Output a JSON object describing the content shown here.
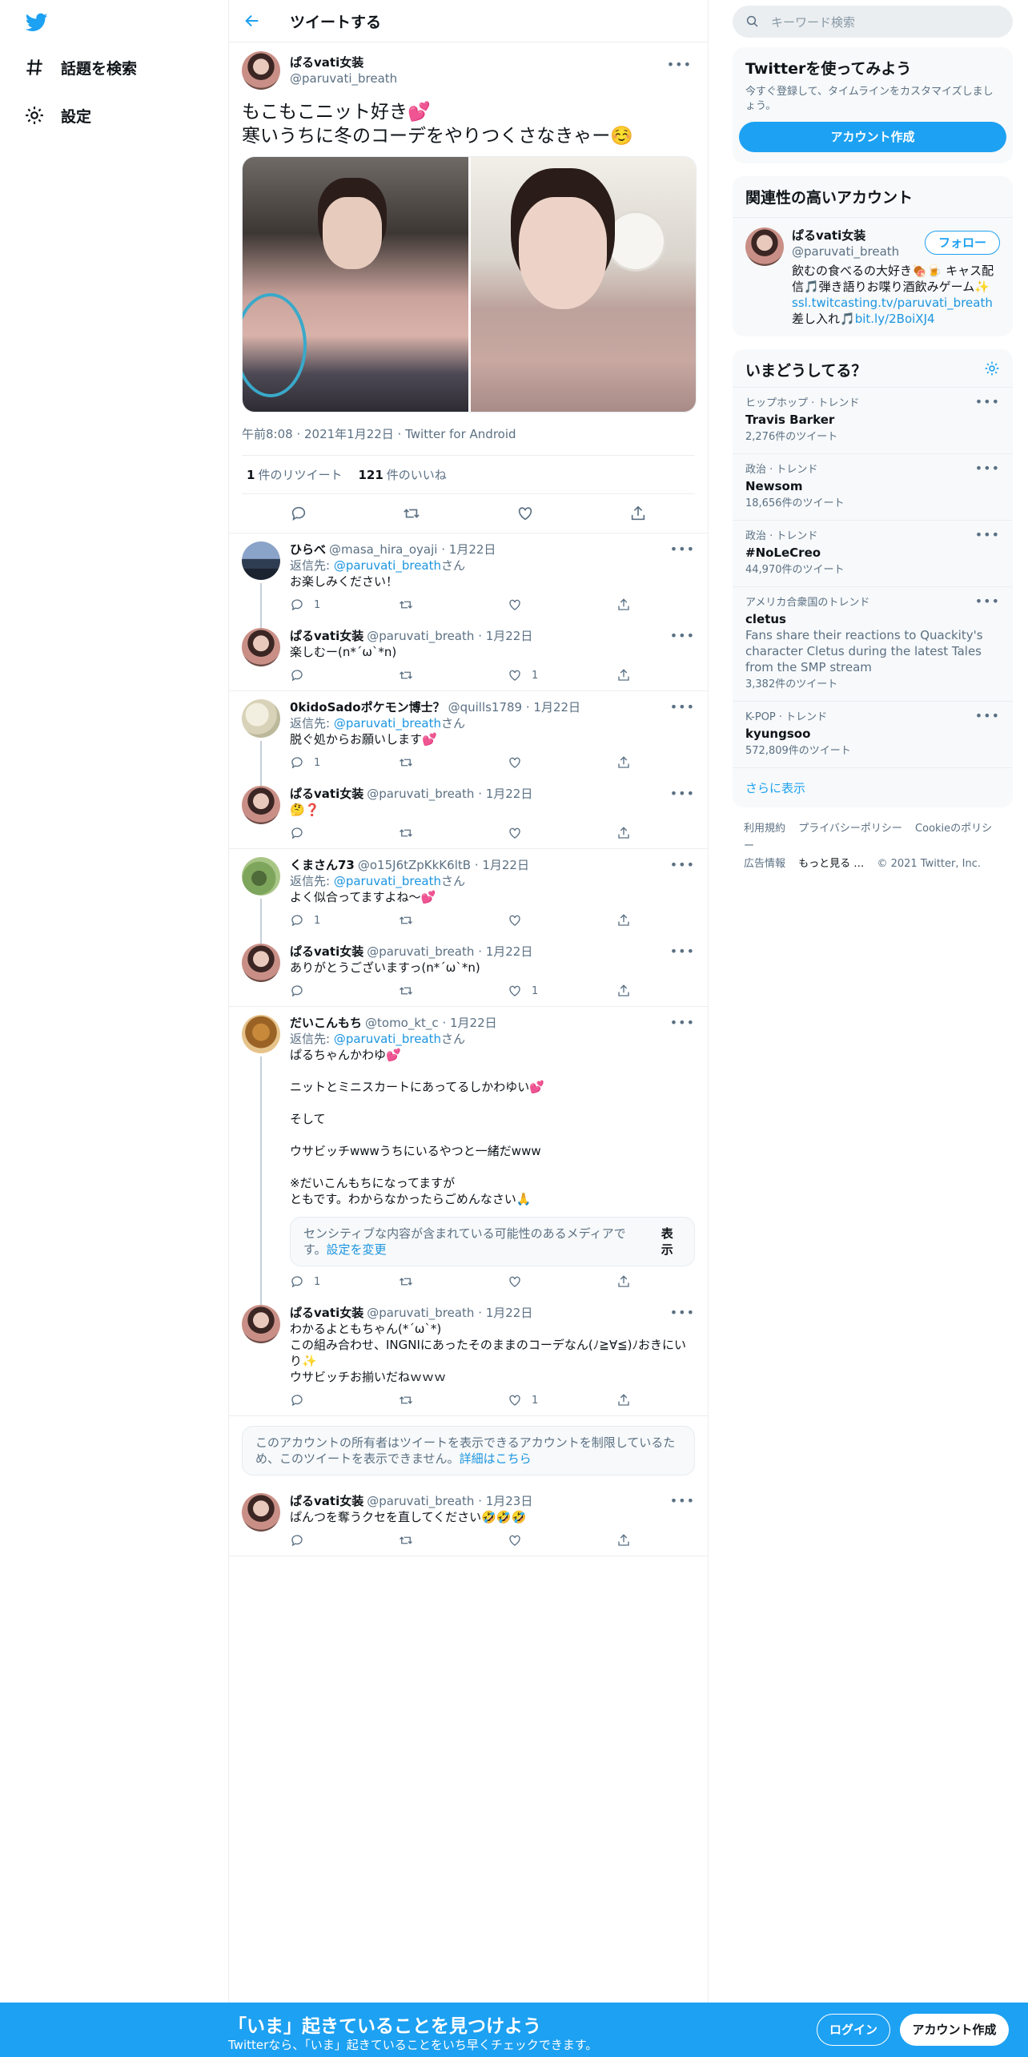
{
  "nav": {
    "explore": "話題を検索",
    "settings": "設定"
  },
  "header": {
    "title": "ツイートする"
  },
  "main_tweet": {
    "name": "ぱるvati女装",
    "handle": "@paruvati_breath",
    "text": "もこもこニット好き💕\n寒いうちに冬のコーデをやりつくさなきゃー☺️",
    "meta": "午前8:08 · 2021年1月22日 · Twitter for Android",
    "retweets_count": "1",
    "retweets_label": "件のリツイート",
    "likes_count": "121",
    "likes_label": "件のいいね"
  },
  "replies": [
    {
      "name": "ひらべ",
      "handle": "@masa_hira_oyaji",
      "date": "· 1月22日",
      "reply_prefix": "返信先: ",
      "reply_to": "@paruvati_breath",
      "reply_suffix": "さん",
      "text": "お楽しみください！",
      "reply_count": "1",
      "like_count": ""
    },
    {
      "name": "ぱるvati女装",
      "handle": "@paruvati_breath",
      "date": "· 1月22日",
      "text": "楽しむー(n*´ω`*n)",
      "reply_count": "",
      "like_count": "1"
    },
    {
      "name": "0kidoSadoポケモン博士？",
      "handle": "@quills1789",
      "date": "· 1月22日",
      "reply_prefix": "返信先: ",
      "reply_to": "@paruvati_breath",
      "reply_suffix": "さん",
      "text": "脱ぐ処からお願いします💕",
      "reply_count": "1",
      "like_count": ""
    },
    {
      "name": "ぱるvati女装",
      "handle": "@paruvati_breath",
      "date": "· 1月22日",
      "text": "🤔❓",
      "reply_count": "",
      "like_count": ""
    },
    {
      "name": "くまさん73",
      "handle": "@o15J6tZpKkK6ltB",
      "date": "· 1月22日",
      "reply_prefix": "返信先: ",
      "reply_to": "@paruvati_breath",
      "reply_suffix": "さん",
      "text": "よく似合ってますよね〜💕",
      "reply_count": "1",
      "like_count": ""
    },
    {
      "name": "ぱるvati女装",
      "handle": "@paruvati_breath",
      "date": "· 1月22日",
      "text": "ありがとうございますっ(n*´ω`*n)",
      "reply_count": "",
      "like_count": "1"
    },
    {
      "name": "だいこんもち",
      "handle": "@tomo_kt_c",
      "date": "· 1月22日",
      "reply_prefix": "返信先: ",
      "reply_to": "@paruvati_breath",
      "reply_suffix": "さん",
      "text": "ぱるちゃんかわゆ💕\n\nニットとミニスカートにあってるしかわゆい💕\n\nそして\n\nウサビッチwwwうちにいるやつと一緒だwww\n\n※だいこんもちになってますが\nともです。わからなかったらごめんなさい🙏",
      "sensitive_text": "センシティブな内容が含まれている可能性のあるメディアです。",
      "sensitive_link": "設定を変更",
      "sensitive_button": "表示",
      "reply_count": "1",
      "like_count": ""
    },
    {
      "name": "ぱるvati女装",
      "handle": "@paruvati_breath",
      "date": "· 1月22日",
      "text": "わかるよともちゃん(*ˊωˋ*)\nこの組み合わせ、INGNIにあったそのままのコーデなん(ﾉ≧∀≦)ﾉおきにいり✨\nウサビッチお揃いだねｗｗｗ",
      "reply_count": "",
      "like_count": "1"
    },
    {
      "name": "ぱるvati女装",
      "handle": "@paruvati_breath",
      "date": "· 1月23日",
      "text": "ぱんつを奪うクセを直してください🤣🤣🤣",
      "reply_count": "",
      "like_count": ""
    }
  ],
  "restricted_notice": {
    "text": "このアカウントの所有者はツイートを表示できるアカウントを制限しているため、このツイートを表示できません。",
    "link": "詳細はこちら"
  },
  "right": {
    "search_placeholder": "キーワード検索",
    "signup_card": {
      "title": "Twitterを使ってみよう",
      "sub": "今すぐ登録して、タイムラインをカスタマイズしましょう。",
      "button": "アカウント作成"
    },
    "relevant": {
      "title": "関連性の高いアカウント",
      "name": "ぱるvati女装",
      "handle": "@paruvati_breath",
      "follow": "フォロー",
      "bio1": "飲むの食べるの大好き🍖🍺 キャス配信🎵弾き語りお喋り酒飲みゲーム✨",
      "link1": "ssl.twitcasting.tv/paruvati_breath",
      "bio2": " 差し入れ🎵",
      "link2": "bit.ly/2BoiXJ4"
    },
    "trends": {
      "title": "いまどうしてる？",
      "items": [
        {
          "ctx": "ヒップホップ · トレンド",
          "name": "Travis Barker",
          "desc": "",
          "count": "2,276件のツイート"
        },
        {
          "ctx": "政治 · トレンド",
          "name": "Newsom",
          "desc": "",
          "count": "18,656件のツイート"
        },
        {
          "ctx": "政治 · トレンド",
          "name": "#NoLeCreo",
          "desc": "",
          "count": "44,970件のツイート"
        },
        {
          "ctx": "アメリカ合衆国のトレンド",
          "name": "cletus",
          "desc": "Fans share their reactions to Quackity's character Cletus during the latest Tales from the SMP stream",
          "count": "3,382件のツイート"
        },
        {
          "ctx": "K-POP · トレンド",
          "name": "kyungsoo",
          "desc": "",
          "count": "572,809件のツイート"
        }
      ],
      "show_more": "さらに表示"
    },
    "footer": {
      "terms": "利用規約",
      "privacy": "プライバシーポリシー",
      "cookie": "Cookieのポリシー",
      "ads": "広告情報",
      "more": "もっと見る …",
      "copyright": "© 2021 Twitter, Inc."
    }
  },
  "banner": {
    "title": "「いま」起きていることを見つけよう",
    "sub": "Twitterなら、「いま」起きていることをいち早くチェックできます。",
    "login": "ログイン",
    "signup": "アカウント作成"
  },
  "colors": {
    "brand": "#1da1f2",
    "link": "#1b95e0",
    "muted": "#5b7083"
  }
}
